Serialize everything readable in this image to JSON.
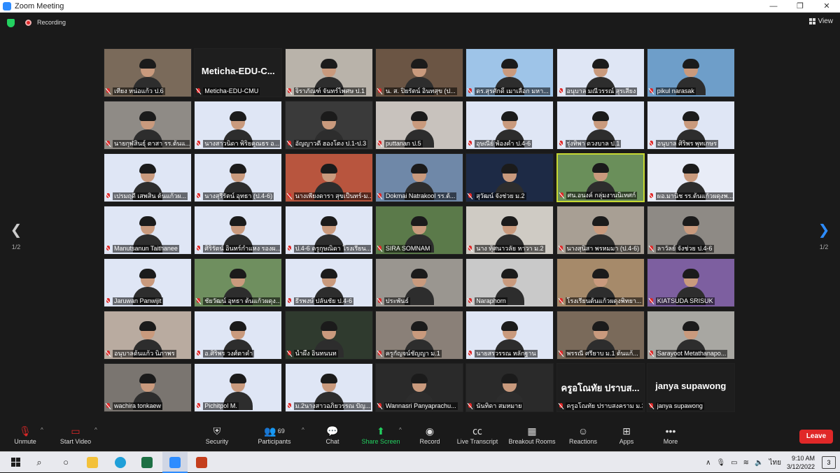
{
  "window": {
    "title": "Zoom Meeting",
    "controls": [
      "—",
      "❐",
      "✕"
    ]
  },
  "status": {
    "recording_label": "Recording",
    "view_label": "View"
  },
  "pager": {
    "left_page": "1/2",
    "right_page": "1/2"
  },
  "participants": [
    {
      "name": "เที่ยง หน่อแก้ว ป.6",
      "big": ""
    },
    {
      "name": "Meticha-EDU-CMU",
      "big": "Meticha-EDU-C..."
    },
    {
      "name": "จิราภัณฑ์ จันทร์ไพศษ ป.1",
      "big": ""
    },
    {
      "name": "น. ส. ปิยรัตน์ อินทสุข (ป...",
      "big": ""
    },
    {
      "name": "ดร.สุรศักดิ์ เมาเลือก มหา...",
      "big": ""
    },
    {
      "name": "อนุบาล มณีวรรณ์ สุรเสียง",
      "big": ""
    },
    {
      "name": "pikul narasak",
      "big": ""
    },
    {
      "name": "นายกุฬสินธุ์ ตาสา รร.ต้นแ...",
      "big": ""
    },
    {
      "name": "นางสาวนิดา พิริยคุณธร อ...",
      "big": ""
    },
    {
      "name": "อัญญาวดี ฮองโตง ป.1-ป.3",
      "big": ""
    },
    {
      "name": "puttanan ป.5",
      "big": ""
    },
    {
      "name": "อุษณีย์ พ้องคำ ป.4-6",
      "big": ""
    },
    {
      "name": "รุ่งทิพา ดวงบาล ป.1",
      "big": ""
    },
    {
      "name": "อนุบาล ศิริพร พุทเกษร",
      "big": ""
    },
    {
      "name": "เปรมฤดี เสพสิน ต้นแก้วผ...",
      "big": ""
    },
    {
      "name": "นางสุรีรัตน์ อุทธา (ป.4-6)",
      "big": ""
    },
    {
      "name": "นางเพียงดารา สุขเป็นทร์-ม...",
      "big": ""
    },
    {
      "name": "Dokmai Natrakool รร.ต้...",
      "big": ""
    },
    {
      "name": "สุวัฒน์ จังช่วย ม.2",
      "big": ""
    },
    {
      "name": "ศน.อนงค์ กลุ่มงานนิเทศก์",
      "big": ""
    },
    {
      "name": "ผอ.มานิช รร.ต้นแก้วผดุงพ...",
      "big": ""
    },
    {
      "name": "Manutsanun Taithanee",
      "big": ""
    },
    {
      "name": "ศิริรัตน์ อินทร์กำแหง รองผ...",
      "big": ""
    },
    {
      "name": "ป.4-6 ครูกุษณิดา โรงเรียน...",
      "big": ""
    },
    {
      "name": "SIRA SOMNAM",
      "big": ""
    },
    {
      "name": "นาง ทุ้ศนาวลัย หาวา ม.2",
      "big": ""
    },
    {
      "name": "นางสุนิสา พรหมมา (ป.4-6)",
      "big": ""
    },
    {
      "name": "ลาวัลย์ จังช่วย ป.4-6",
      "big": ""
    },
    {
      "name": "Jaruwan Panwijit",
      "big": ""
    },
    {
      "name": "ชัยวัฒน์ อุทธา ต้นแก้วผดุง...",
      "big": ""
    },
    {
      "name": "ธีรพงษ์ ปลันชัย ป.4-6",
      "big": ""
    },
    {
      "name": "ประพันธ์",
      "big": ""
    },
    {
      "name": "Naraphorn",
      "big": ""
    },
    {
      "name": "โรงเรียนต้นแก้วผดุงพิทยา...",
      "big": ""
    },
    {
      "name": "KIATSUDA SRISUK",
      "big": ""
    },
    {
      "name": "อนุบาลต้นแก้ว นิภาพร",
      "big": ""
    },
    {
      "name": "อ.ศิริพร วงศ์ตาคำ",
      "big": ""
    },
    {
      "name": "น้ำผึ้ง อินทนนท",
      "big": ""
    },
    {
      "name": "ครูกัญจน์ชัญญา ม.1",
      "big": ""
    },
    {
      "name": "นายสรวรรณ หลักฐาน",
      "big": ""
    },
    {
      "name": "พรรณี ศรียาบ ม.1 ต้นแก้...",
      "big": ""
    },
    {
      "name": "Sarayoot Metathanapo...",
      "big": ""
    },
    {
      "name": "wachira tonkaew",
      "big": ""
    },
    {
      "name": "Pichitpol M.",
      "big": ""
    },
    {
      "name": "ม.2นางสาวอภิยวรรณ ปัญ...",
      "big": ""
    },
    {
      "name": "Wannasri Panyaprachu...",
      "big": ""
    },
    {
      "name": "นันทิดา สมหมาย",
      "big": ""
    },
    {
      "name": "ครูอโณทัย ปราบสงคราม ม.3",
      "big": "ครูอโณทัย ปราบส..."
    },
    {
      "name": "janya supawong",
      "big": "janya supawong"
    }
  ],
  "tile_backgrounds": [
    "#7a6a5a",
    "#1e1e1e",
    "#b9b3aa",
    "#6b5544",
    "#9ec4e8",
    "#dfe6f5",
    "#6e9ec9",
    "#8f8b86",
    "#dfe6f5",
    "#3a3a3a",
    "#c8c2bd",
    "#dfe6f5",
    "#dfe6f5",
    "#dfe6f5",
    "#dfe6f5",
    "#dfe6f5",
    "#b8553e",
    "#6f88a8",
    "#1d2a45",
    "#6a8f5a",
    "#e8ecf7",
    "#dfe6f5",
    "#dfe6f5",
    "#dfe6f5",
    "#5b7a4a",
    "#cfcbc4",
    "#a89f94",
    "#8e8a85",
    "#dfe6f5",
    "#6f8f5f",
    "#dfe6f5",
    "#9a9690",
    "#c9c9c9",
    "#a68a6a",
    "#7d5fa0",
    "#b9aba0",
    "#dfe6f5",
    "#2f3a2e",
    "#8a8078",
    "#dfe6f5",
    "#7a6a5a",
    "#a8a7a2",
    "#7a7570",
    "#dfe6f5",
    "#dfe6f5",
    "#2a2a2a",
    "#2a2a2a",
    "#1e1e1e",
    "#1e1e1e"
  ],
  "active_tile_index": 19,
  "toolbar": {
    "unmute": "Unmute",
    "start_video": "Start Video",
    "security": "Security",
    "participants": "Participants",
    "participants_count": "69",
    "chat": "Chat",
    "share_screen": "Share Screen",
    "record": "Record",
    "live_transcript": "Live Transcript",
    "breakout_rooms": "Breakout Rooms",
    "reactions": "Reactions",
    "apps": "Apps",
    "more": "More",
    "leave": "Leave"
  },
  "taskbar": {
    "time": "9:10 AM",
    "date": "3/12/2022",
    "language": "ไทย",
    "notifications": "3"
  },
  "colors": {
    "accent": "#2d8cff",
    "share_green": "#23d160",
    "leave_red": "#e02828",
    "active_speaker": "#c6d832"
  }
}
